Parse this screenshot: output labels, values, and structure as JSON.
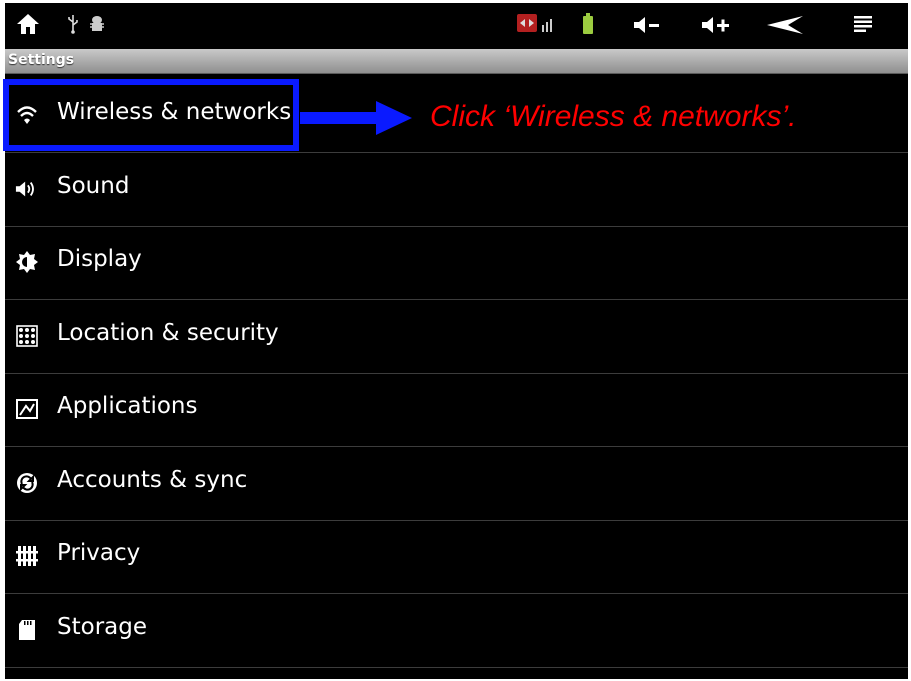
{
  "app": {
    "title": "Settings"
  },
  "status_bar": {
    "icons": [
      "home-icon",
      "usb-icon",
      "android-debug-icon",
      "network-icon",
      "signal-icon",
      "battery-icon",
      "volume-down-icon",
      "volume-up-icon",
      "back-icon",
      "menu-icon"
    ]
  },
  "settings": {
    "items": [
      {
        "label": "Wireless & networks",
        "icon": "wifi-icon"
      },
      {
        "label": "Sound",
        "icon": "speaker-icon"
      },
      {
        "label": "Display",
        "icon": "brightness-icon"
      },
      {
        "label": "Location & security",
        "icon": "grid-lock-icon"
      },
      {
        "label": "Applications",
        "icon": "applications-icon"
      },
      {
        "label": "Accounts & sync",
        "icon": "sync-icon"
      },
      {
        "label": "Privacy",
        "icon": "privacy-icon"
      },
      {
        "label": "Storage",
        "icon": "sd-card-icon"
      }
    ]
  },
  "annotation": {
    "callout": "Click ‘Wireless & networks’.",
    "highlight_color": "#0a1aff",
    "text_color": "#ff0000"
  }
}
